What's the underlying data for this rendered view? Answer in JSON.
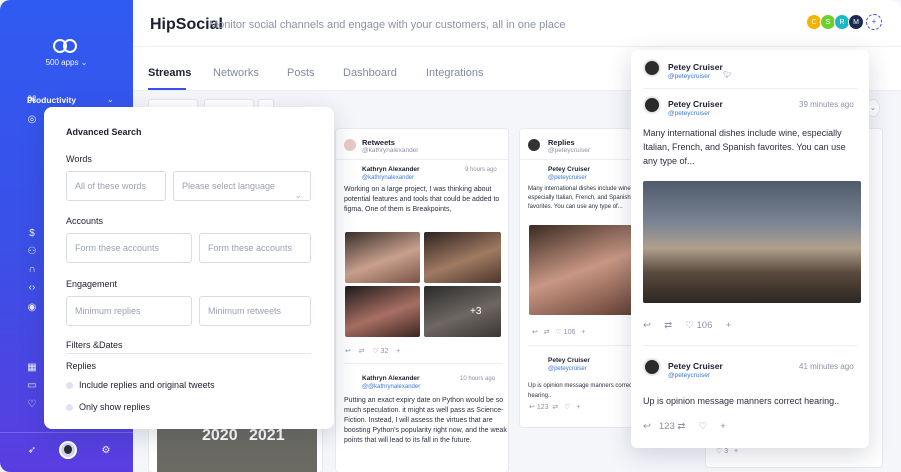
{
  "sidebar": {
    "apps_label": "500 apps",
    "productivity_label": "Productivity"
  },
  "header": {
    "title": "HipSocial",
    "subtitle": "Monitor social channels and engage with your customers, all in one place",
    "team": [
      {
        "initial": "C",
        "color": "#f5b300"
      },
      {
        "initial": "S",
        "color": "#6ccf2f"
      },
      {
        "initial": "R",
        "color": "#1db7c5"
      },
      {
        "initial": "M",
        "color": "#1b2a4f"
      }
    ]
  },
  "tabs": [
    "Streams",
    "Networks",
    "Posts",
    "Dashboard",
    "Integrations"
  ],
  "columns": {
    "retweets": {
      "title": "Retweets",
      "handle": "@kathrynalexander",
      "tweet1": {
        "name": "Kathryn Alexander",
        "handle": "@kathrynalexander",
        "time": "9 hours ago",
        "text": "Working on a large project, I was thinking about potential features and tools that could be added to figma, One of them is Breakpoints,",
        "more_images": "+3",
        "likes": "32"
      },
      "tweet2": {
        "name": "Kathryn Alexander",
        "handle": "@@kathrynalexander",
        "time": "10 hours ago",
        "text": "Putting an exact expiry date on Python would be so much speculation. it might as well pass as Science-Fiction. Instead, I will assess the virtues that are boosting Python's popularity right now, and the weak points that will lead to its fall in the future."
      }
    },
    "replies": {
      "title": "Replies",
      "handle": "@peteycruiser",
      "tweet1": {
        "name": "Petey Cruiser",
        "handle": "@peteycruiser",
        "text": "Many international dishes include wine, especially Italian, French, and Spanish favorites. You can use any type of...",
        "likes": "106"
      },
      "tweet2": {
        "name": "Petey Cruiser",
        "handle": "@peteycruiser",
        "text": "Up is opinion message manners correct hearing..",
        "retweets": "123"
      }
    },
    "meme_text": [
      "2020",
      "2021"
    ]
  },
  "advanced_search": {
    "title": "Advanced Search",
    "words_label": "Words",
    "words_placeholder": "All of these words",
    "language_placeholder": "Please select language",
    "accounts_label": "Accounts",
    "accounts_placeholder_1": "Form these accounts",
    "accounts_placeholder_2": "Form these accounts",
    "engagement_label": "Engagement",
    "min_replies_placeholder": "Minimum replies",
    "min_retweets_placeholder": "Minimum retweets",
    "filters_label": "Filters &Dates",
    "replies_label": "Replies",
    "option_1": "Include replies and original tweets",
    "option_2": "Only show replies"
  },
  "popover": {
    "header_name": "Petey Cruiser",
    "header_handle": "@peteycruiser",
    "post1": {
      "name": "Petey Cruiser",
      "handle": "@peteycruiser",
      "time": "39 minutes ago",
      "text": "Many international dishes include wine, especially Italian, French, and Spanish favorites. You can use any type of...",
      "likes": "106"
    },
    "post2": {
      "name": "Petey Cruiser",
      "handle": "@peteycruiser",
      "time": "41 minutes ago",
      "text": "Up is opinion message manners correct hearing..",
      "retweets": "123"
    }
  },
  "far_right": {
    "count": "3"
  }
}
